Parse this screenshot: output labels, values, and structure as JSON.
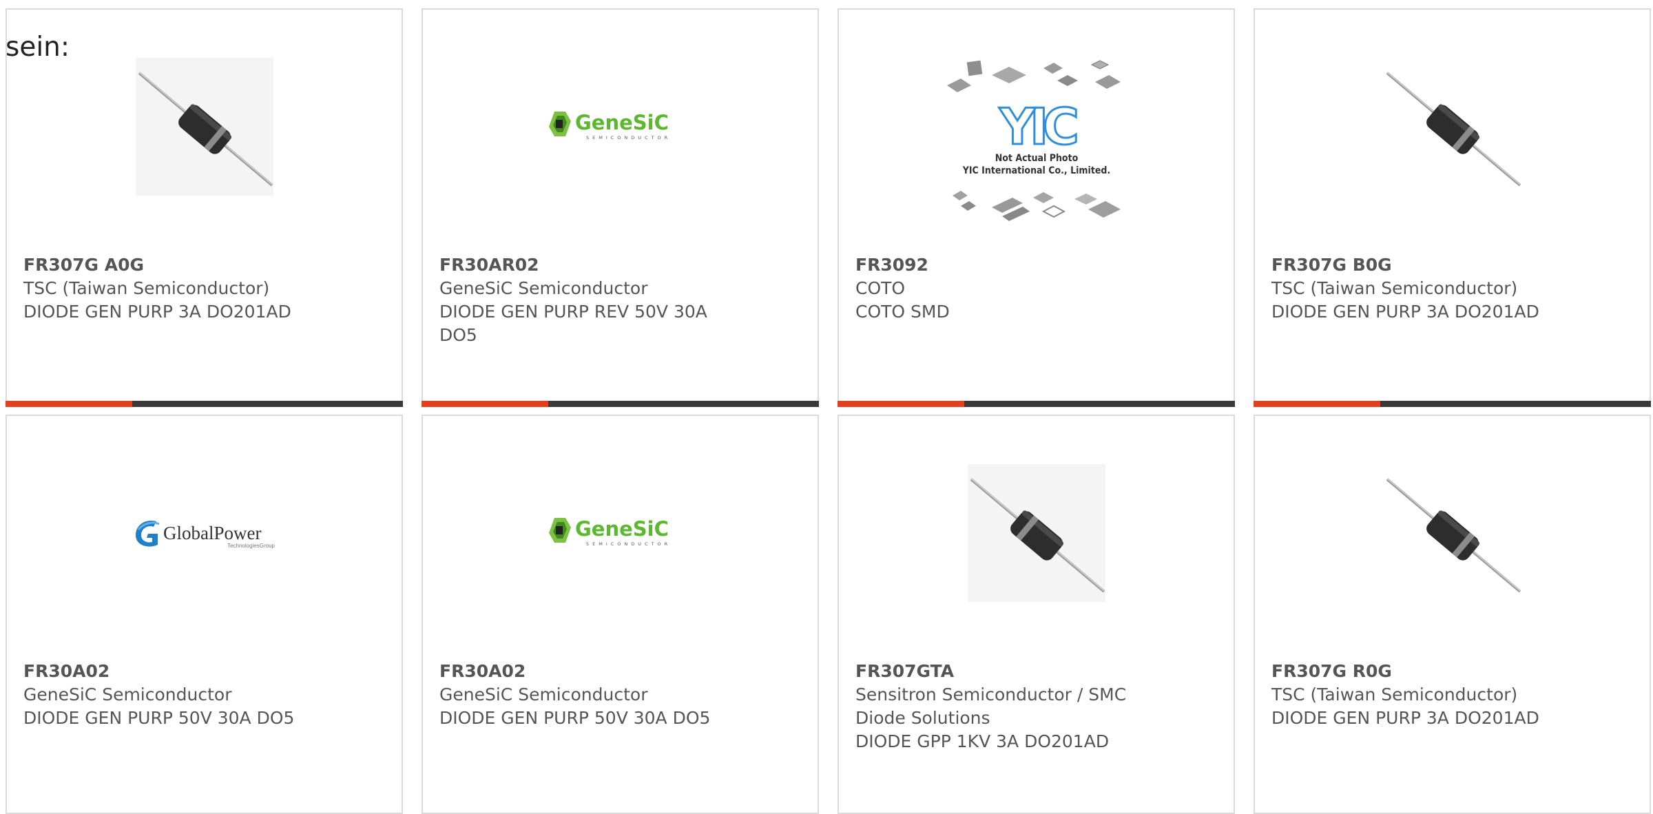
{
  "stray_label": "sein:",
  "colors": {
    "accent": "#e2401f",
    "bar": "#3a3a3a",
    "card_border": "#dadada",
    "text": "#555555"
  },
  "cards": [
    {
      "part": "FR307G A0G",
      "manufacturer": "TSC (Taiwan Semiconductor)",
      "description": "DIODE GEN PURP 3A DO201AD",
      "image": "axial-diode-photo"
    },
    {
      "part": "FR30AR02",
      "manufacturer": "GeneSiC Semiconductor",
      "description": "DIODE GEN PURP REV 50V 30A DO5",
      "image": "genesic-logo",
      "logo_text": "GeneSiC",
      "logo_subtext": "SEMICONDUCTOR"
    },
    {
      "part": "FR3092",
      "manufacturer": "COTO",
      "description": "COTO SMD",
      "image": "yic-placeholder",
      "logo_text": "YIC",
      "photo_note_1": "Not Actual Photo",
      "photo_note_2": "YIC International Co., Limited."
    },
    {
      "part": "FR307G B0G",
      "manufacturer": "TSC (Taiwan Semiconductor)",
      "description": "DIODE GEN PURP 3A DO201AD",
      "image": "axial-diode-photo"
    },
    {
      "part": "FR30A02",
      "manufacturer": "GeneSiC Semiconductor",
      "description": "DIODE GEN PURP 50V 30A DO5",
      "image": "globalpower-logo",
      "logo_text": "GlobalPower",
      "logo_subtext": "TechnologiesGroup"
    },
    {
      "part": "FR30A02",
      "manufacturer": "GeneSiC Semiconductor",
      "description": "DIODE GEN PURP 50V 30A DO5",
      "image": "genesic-logo",
      "logo_text": "GeneSiC",
      "logo_subtext": "SEMICONDUCTOR"
    },
    {
      "part": "FR307GTA",
      "manufacturer": "Sensitron Semiconductor / SMC Diode Solutions",
      "description": "DIODE GPP 1KV 3A DO201AD",
      "image": "axial-diode-photo"
    },
    {
      "part": "FR307G R0G",
      "manufacturer": "TSC (Taiwan Semiconductor)",
      "description": "DIODE GEN PURP 3A DO201AD",
      "image": "axial-diode-photo"
    }
  ]
}
